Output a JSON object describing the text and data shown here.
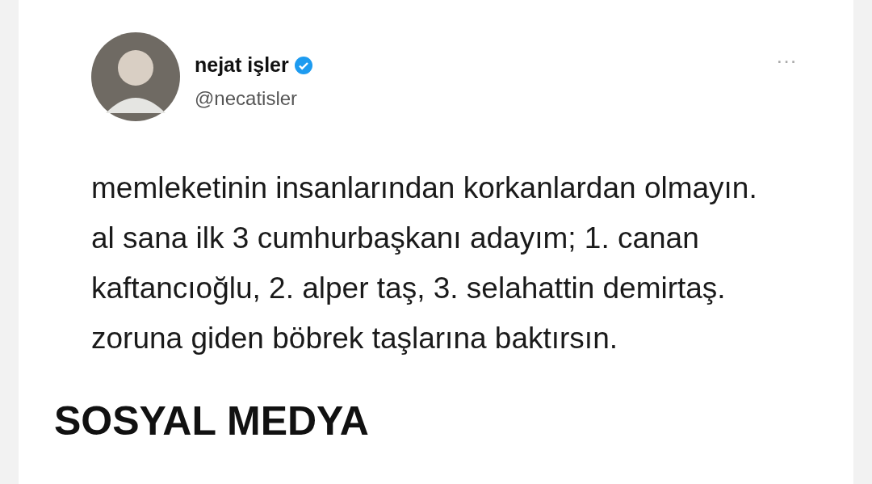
{
  "tweet": {
    "name": "nejat işler",
    "verified": true,
    "handle": "@necatisler",
    "more": "···",
    "text": "memleketinin insanlarından korkanlardan olmayın. al sana ilk 3 cumhurbaşkanı adayım; 1. canan kaftancıoğlu, 2. alper taş, 3. selahattin demirtaş. zoruna giden böbrek taşlarına baktırsın."
  },
  "heading": "SOSYAL MEDYA"
}
